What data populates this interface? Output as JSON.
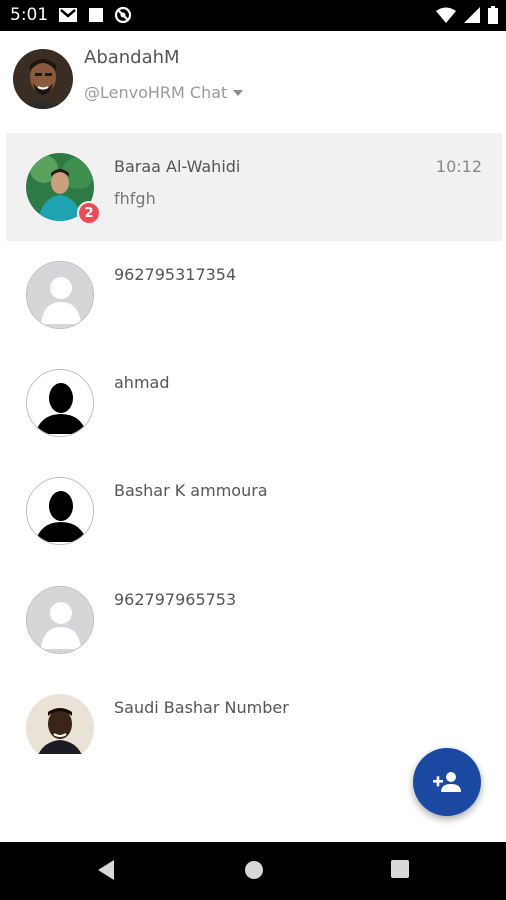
{
  "status_bar": {
    "time": "5:01",
    "icons_left": [
      "gmail-icon",
      "square-icon",
      "blocked-icon"
    ],
    "icons_right": [
      "wifi-icon",
      "signal-icon",
      "battery-icon"
    ]
  },
  "header": {
    "user_name": "AbandahM",
    "workspace": "@LenvoHRM Chat"
  },
  "conversations": [
    {
      "name": "Baraa Al-Wahidi",
      "last_message": "fhfgh",
      "time": "10:12",
      "unread": "2",
      "avatar": "photo-teal"
    },
    {
      "name": "962795317354",
      "last_message": "",
      "time": "",
      "avatar": "placeholder-grey"
    },
    {
      "name": "ahmad",
      "last_message": "",
      "time": "",
      "avatar": "silhouette-black"
    },
    {
      "name": "Bashar K ammoura",
      "last_message": "",
      "time": "",
      "avatar": "silhouette-black"
    },
    {
      "name": "962797965753",
      "last_message": "",
      "time": "",
      "avatar": "placeholder-grey"
    },
    {
      "name": "Saudi Bashar Number",
      "last_message": "",
      "time": "",
      "avatar": "photo-person"
    }
  ],
  "fab": {
    "icon": "add-person-icon"
  },
  "colors": {
    "fab": "#1b49a1",
    "badge": "#e94b57",
    "active_row": "#f1f1f1"
  }
}
